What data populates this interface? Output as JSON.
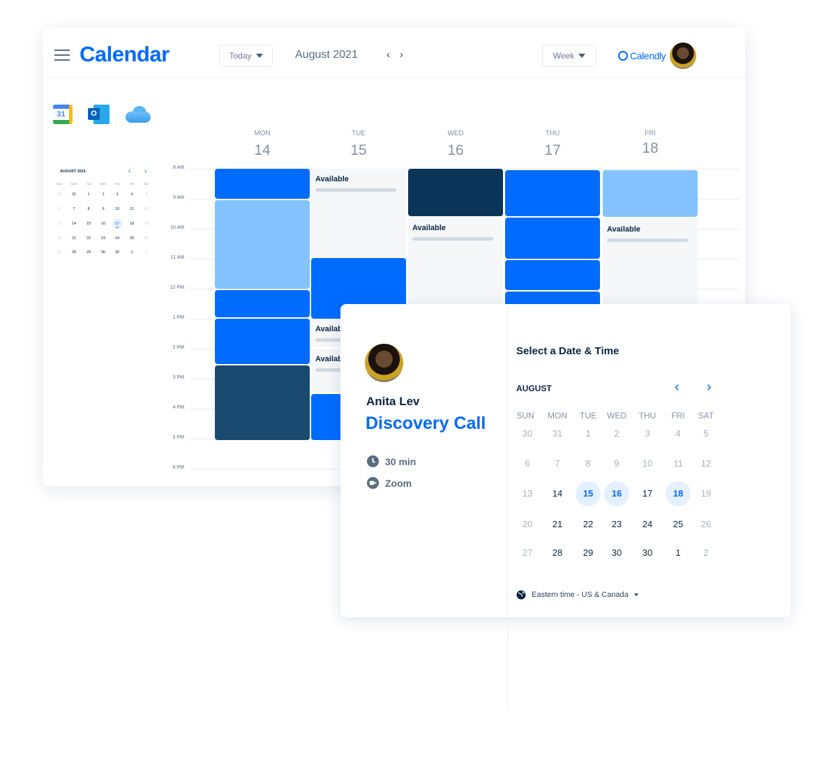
{
  "header": {
    "title": "Calendar",
    "today_label": "Today",
    "month_label": "August 2021",
    "view_label": "Week",
    "brand": "Calendly"
  },
  "integrations": [
    "google-calendar-icon",
    "outlook-icon",
    "icloud-icon"
  ],
  "mini_calendar": {
    "title": "AUGUST 2021",
    "weekdays": [
      "SUN",
      "MON",
      "TUE",
      "WED",
      "THU",
      "FRI",
      "SAT"
    ],
    "weeks": [
      [
        "30",
        "31",
        "1",
        "2",
        "3",
        "4",
        "5"
      ],
      [
        "6",
        "7",
        "8",
        "9",
        "10",
        "11",
        "12"
      ],
      [
        "13",
        "14",
        "15",
        "16",
        "17",
        "18",
        "19"
      ],
      [
        "20",
        "21",
        "22",
        "23",
        "24",
        "25",
        "26"
      ],
      [
        "27",
        "28",
        "29",
        "30",
        "30",
        "1",
        "2"
      ]
    ],
    "selected": "17"
  },
  "week": {
    "days": [
      {
        "label": "MON",
        "num": "14"
      },
      {
        "label": "TUE",
        "num": "15"
      },
      {
        "label": "WED",
        "num": "16"
      },
      {
        "label": "THU",
        "num": "17"
      },
      {
        "label": "FRI",
        "num": "18"
      }
    ],
    "hours": [
      "8 AM",
      "9 AM",
      "10 AM",
      "11 AM",
      "12 PM",
      "1 PM",
      "2 PM",
      "3 PM",
      "4 PM",
      "5 PM",
      "6 PM"
    ],
    "available_label": "Available",
    "events": [
      {
        "day": 0,
        "start": 8,
        "end": 9,
        "type": "blue"
      },
      {
        "day": 0,
        "start": 9.05,
        "end": 12,
        "type": "light"
      },
      {
        "day": 0,
        "start": 12.05,
        "end": 12.95,
        "type": "blue"
      },
      {
        "day": 0,
        "start": 13,
        "end": 14.5,
        "type": "blue"
      },
      {
        "day": 0,
        "start": 14.55,
        "end": 17.05,
        "type": "navy"
      },
      {
        "day": 1,
        "start": 8,
        "end": 10.95,
        "type": "avail"
      },
      {
        "day": 1,
        "start": 10.98,
        "end": 13,
        "type": "blue"
      },
      {
        "day": 1,
        "start": 13,
        "end": 13.95,
        "type": "avail"
      },
      {
        "day": 1,
        "start": 14,
        "end": 15.45,
        "type": "avail"
      },
      {
        "day": 1,
        "start": 15.5,
        "end": 17.05,
        "type": "blue"
      },
      {
        "day": 2,
        "start": 8,
        "end": 9.57,
        "type": "dark"
      },
      {
        "day": 2,
        "start": 9.62,
        "end": 13,
        "type": "avail"
      },
      {
        "day": 3,
        "start": 8.05,
        "end": 9.57,
        "type": "blue"
      },
      {
        "day": 3,
        "start": 9.62,
        "end": 11,
        "type": "blue"
      },
      {
        "day": 3,
        "start": 11.05,
        "end": 12.05,
        "type": "blue"
      },
      {
        "day": 3,
        "start": 12.1,
        "end": 13,
        "type": "blue"
      },
      {
        "day": 4,
        "start": 8.05,
        "end": 9.6,
        "type": "light"
      },
      {
        "day": 4,
        "start": 9.68,
        "end": 13,
        "type": "avail"
      }
    ]
  },
  "booking": {
    "host": "Anita Lev",
    "event_name": "Discovery Call",
    "duration": "30 min",
    "location": "Zoom",
    "title": "Select a Date & Time",
    "month": "AUGUST",
    "weekdays": [
      "SUN",
      "MON",
      "TUE",
      "WED",
      "THU",
      "FRI",
      "SAT"
    ],
    "weeks": [
      [
        [
          "30",
          "muted"
        ],
        [
          "31",
          "muted"
        ],
        [
          "1",
          "muted"
        ],
        [
          "2",
          "muted"
        ],
        [
          "3",
          "muted"
        ],
        [
          "4",
          "muted"
        ],
        [
          "5",
          "muted"
        ]
      ],
      [
        [
          "6",
          "muted"
        ],
        [
          "7",
          "muted"
        ],
        [
          "8",
          "muted"
        ],
        [
          "9",
          "muted"
        ],
        [
          "10",
          "muted"
        ],
        [
          "11",
          "muted"
        ],
        [
          "12",
          "muted"
        ]
      ],
      [
        [
          "13",
          "muted"
        ],
        [
          "14",
          "normal"
        ],
        [
          "15",
          "avail"
        ],
        [
          "16",
          "avail"
        ],
        [
          "17",
          "normal"
        ],
        [
          "18",
          "avail"
        ],
        [
          "19",
          "muted"
        ]
      ],
      [
        [
          "20",
          "muted"
        ],
        [
          "21",
          "normal"
        ],
        [
          "22",
          "normal"
        ],
        [
          "23",
          "normal"
        ],
        [
          "24",
          "normal"
        ],
        [
          "25",
          "normal"
        ],
        [
          "26",
          "muted"
        ]
      ],
      [
        [
          "27",
          "muted"
        ],
        [
          "28",
          "normal"
        ],
        [
          "29",
          "normal"
        ],
        [
          "30",
          "normal"
        ],
        [
          "30",
          "normal"
        ],
        [
          "1",
          "normal"
        ],
        [
          "2",
          "muted"
        ]
      ]
    ],
    "timezone": "Eastern time - US & Canada"
  },
  "colors": {
    "brand": "#0069ff",
    "busy": "#006bff",
    "tentative": "#85c3ff",
    "dark": "#0b3558",
    "available_bg": "#f5f7f9"
  }
}
